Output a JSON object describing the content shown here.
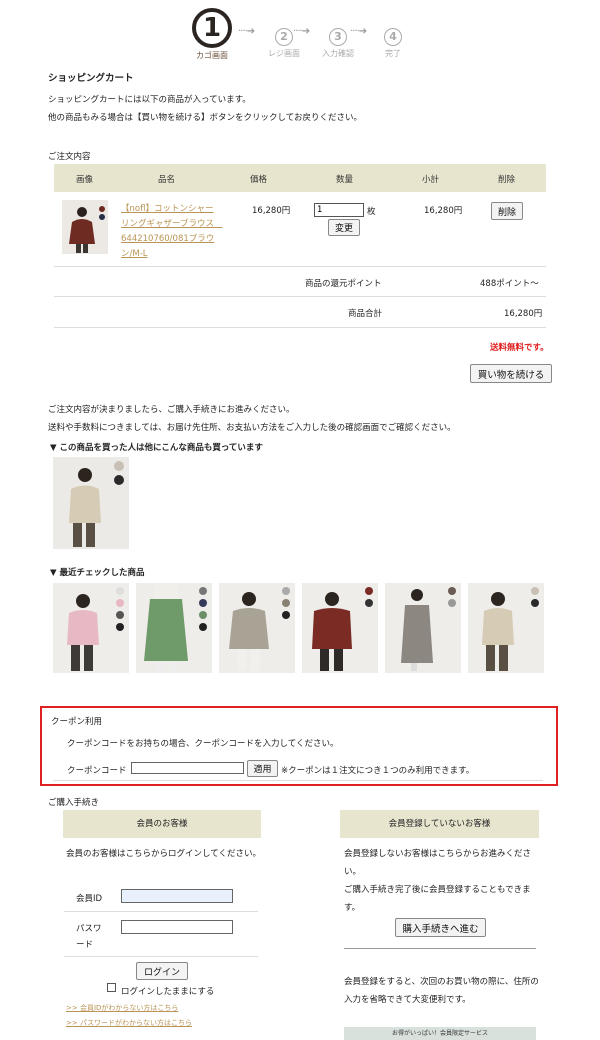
{
  "steps": [
    {
      "num": "1",
      "label": "カゴ画面"
    },
    {
      "num": "2",
      "label": "レジ画面"
    },
    {
      "num": "3",
      "label": "入力確認"
    },
    {
      "num": "4",
      "label": "完了"
    }
  ],
  "cart": {
    "title": "ショッピングカート",
    "intro1": "ショッピングカートには以下の商品が入っています。",
    "intro2": "他の商品もみる場合は【買い物を続ける】ボタンをクリックしてお戻りください。"
  },
  "order": {
    "label": "ご注文内容",
    "headers": [
      "画像",
      "品名",
      "価格",
      "数量",
      "小計",
      "削除"
    ],
    "item": {
      "name": "【nofl】コットンシャーリングギャザーブラウス　644210760/081ブラウン/M-L",
      "price": "16,280円",
      "qty": "1",
      "qty_unit": "枚",
      "subtotal": "16,280円",
      "delete_label": "削除",
      "update_label": "変更"
    },
    "points_label": "商品の還元ポイント",
    "points_value": "488ポイント〜",
    "total_label": "商品合計",
    "total_value": "16,280円",
    "free_shipping": "送料無料です。",
    "continue_label": "買い物を続ける"
  },
  "notes": {
    "line1": "ご注文内容が決まりましたら、ご購入手続きにお進みください。",
    "line2": "送料や手数料につきましては、お届け先住所、お支払い方法をご入力した後の確認画面でご確認ください。"
  },
  "also_bought": {
    "title": "▼ この商品を買った人は他にこんな商品も買っています"
  },
  "recent": {
    "title": "▼ 最近チェックした商品"
  },
  "coupon": {
    "title": "クーポン利用",
    "desc": "クーポンコードをお持ちの場合、クーポンコードを入力してください。",
    "field_label": "クーポンコード",
    "input_value": "",
    "apply_label": "適用",
    "note": "※クーポンは１注文につき１つのみ利用できます。"
  },
  "procedure": {
    "title": "ご購入手続き",
    "member": {
      "head": "会員のお客様",
      "desc": "会員のお客様はこちらからログインしてください。",
      "id_label": "会員ID",
      "id_value": "",
      "pw_label1": "パスワ",
      "pw_label2": "ード",
      "pw_value": "",
      "login_label": "ログイン",
      "keep_login": "ログインしたままにする",
      "forgot_id": ">> 会員IDがわからない方はこちら",
      "forgot_pw": ">> パスワードがわからない方はこちら"
    },
    "guest": {
      "head": "会員登録していないお客様",
      "desc1": "会員登録しないお客様はこちらからお進みください。",
      "desc2": "ご購入手続き完了後に会員登録することもできます。",
      "proceed_label": "購入手続きへ進む",
      "benefit": "会員登録をすると、次回のお買い物の際に、住所の入力を省略できて大変便利です。",
      "banner": "お得がいっぱい！会員限定サービス"
    }
  },
  "colors": {
    "accent": "#b99454",
    "header_bg": "#e8e5cf",
    "alert": "#e02020",
    "step_active": "#2b2522"
  }
}
